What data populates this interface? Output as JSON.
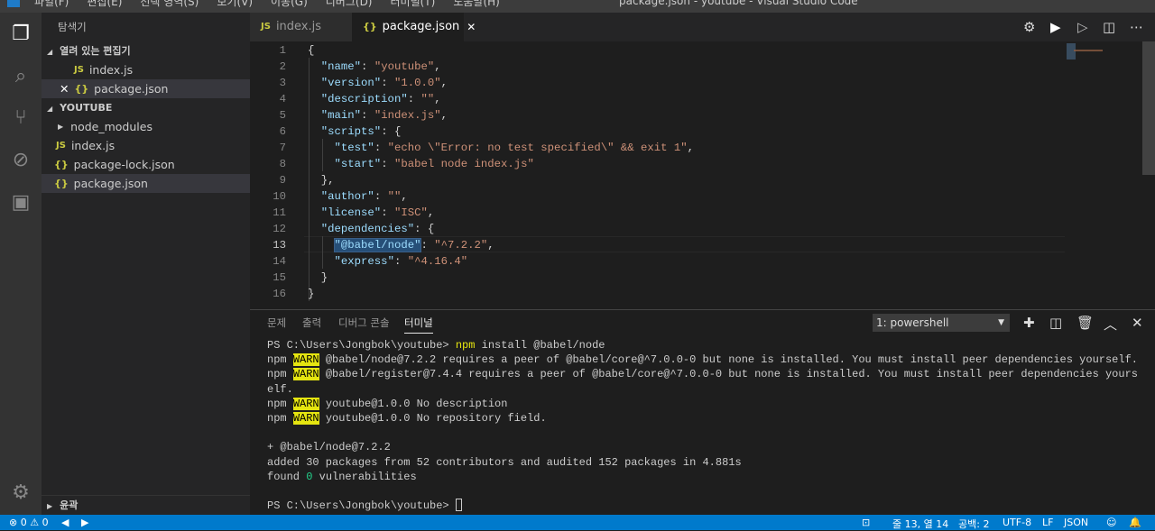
{
  "window": {
    "title": "package.json - youtube - Visual Studio Code",
    "menu": [
      "파일(F)",
      "편집(E)",
      "선택 영역(S)",
      "보기(V)",
      "이동(G)",
      "디버그(D)",
      "터미널(T)",
      "도움말(H)"
    ]
  },
  "activity": [
    "files-icon",
    "search-icon",
    "source-control-icon",
    "debug-icon",
    "extensions-icon"
  ],
  "sidebar": {
    "title": "탐색기",
    "open_editors_label": "열려 있는 편집기",
    "open_editors": [
      {
        "name": "index.js",
        "type": "js"
      },
      {
        "name": "package.json",
        "type": "json"
      }
    ],
    "folder_label": "YOUTUBE",
    "files": [
      {
        "name": "node_modules",
        "type": "folder"
      },
      {
        "name": "index.js",
        "type": "js"
      },
      {
        "name": "package-lock.json",
        "type": "json"
      },
      {
        "name": "package.json",
        "type": "json"
      }
    ],
    "outline_label": "윤곽",
    "js_badge": "JS",
    "json_badge": "{}"
  },
  "tabs": [
    {
      "label": "index.js",
      "type": "js"
    },
    {
      "label": "package.json",
      "type": "json",
      "active": true
    }
  ],
  "editor": {
    "current_line": 13,
    "lines": [
      [
        [
          "p",
          "{"
        ]
      ],
      [
        [
          "p",
          "  "
        ],
        [
          "k",
          "\"name\""
        ],
        [
          "p",
          ": "
        ],
        [
          "s",
          "\"youtube\""
        ],
        [
          "p",
          ","
        ]
      ],
      [
        [
          "p",
          "  "
        ],
        [
          "k",
          "\"version\""
        ],
        [
          "p",
          ": "
        ],
        [
          "s",
          "\"1.0.0\""
        ],
        [
          "p",
          ","
        ]
      ],
      [
        [
          "p",
          "  "
        ],
        [
          "k",
          "\"description\""
        ],
        [
          "p",
          ": "
        ],
        [
          "s",
          "\"\""
        ],
        [
          "p",
          ","
        ]
      ],
      [
        [
          "p",
          "  "
        ],
        [
          "k",
          "\"main\""
        ],
        [
          "p",
          ": "
        ],
        [
          "s",
          "\"index.js\""
        ],
        [
          "p",
          ","
        ]
      ],
      [
        [
          "p",
          "  "
        ],
        [
          "k",
          "\"scripts\""
        ],
        [
          "p",
          ": {"
        ]
      ],
      [
        [
          "p",
          "    "
        ],
        [
          "k",
          "\"test\""
        ],
        [
          "p",
          ": "
        ],
        [
          "s",
          "\"echo \\\"Error: no test specified\\\" && exit 1\""
        ],
        [
          "p",
          ","
        ]
      ],
      [
        [
          "p",
          "    "
        ],
        [
          "k",
          "\"start\""
        ],
        [
          "p",
          ": "
        ],
        [
          "s",
          "\"babel node index.js\""
        ]
      ],
      [
        [
          "p",
          "  },"
        ]
      ],
      [
        [
          "p",
          "  "
        ],
        [
          "k",
          "\"author\""
        ],
        [
          "p",
          ": "
        ],
        [
          "s",
          "\"\""
        ],
        [
          "p",
          ","
        ]
      ],
      [
        [
          "p",
          "  "
        ],
        [
          "k",
          "\"license\""
        ],
        [
          "p",
          ": "
        ],
        [
          "s",
          "\"ISC\""
        ],
        [
          "p",
          ","
        ]
      ],
      [
        [
          "p",
          "  "
        ],
        [
          "k",
          "\"dependencies\""
        ],
        [
          "p",
          ": {"
        ]
      ],
      [
        [
          "p",
          "    "
        ],
        [
          "hl",
          "\"@babel/node\""
        ],
        [
          "p",
          ": "
        ],
        [
          "s",
          "\"^7.2.2\""
        ],
        [
          "p",
          ","
        ]
      ],
      [
        [
          "p",
          "    "
        ],
        [
          "k",
          "\"express\""
        ],
        [
          "p",
          ": "
        ],
        [
          "s",
          "\"^4.16.4\""
        ]
      ],
      [
        [
          "p",
          "  }"
        ]
      ],
      [
        [
          "p",
          "}"
        ]
      ]
    ]
  },
  "panel": {
    "tabs": [
      "문제",
      "출력",
      "디버그 콘솔",
      "터미널"
    ],
    "active_tab": "터미널",
    "terminal_select": "1: powershell",
    "terminal": [
      [
        [
          "t",
          "PS C:\\Users\\Jongbok\\youtube> "
        ],
        [
          "y",
          "npm"
        ],
        [
          "t",
          " install @babel/node"
        ]
      ],
      [
        [
          "t",
          "npm "
        ],
        [
          "w",
          "WARN"
        ],
        [
          "t",
          " @babel/node@7.2.2 requires a peer of @babel/core@^7.0.0-0 but none is installed. You must install peer dependencies yourself."
        ]
      ],
      [
        [
          "t",
          "npm "
        ],
        [
          "w",
          "WARN"
        ],
        [
          "t",
          " @babel/register@7.4.4 requires a peer of @babel/core@^7.0.0-0 but none is installed. You must install peer dependencies yours"
        ]
      ],
      [
        [
          "t",
          "elf."
        ]
      ],
      [
        [
          "t",
          "npm "
        ],
        [
          "w",
          "WARN"
        ],
        [
          "t",
          " youtube@1.0.0 No description"
        ]
      ],
      [
        [
          "t",
          "npm "
        ],
        [
          "w",
          "WARN"
        ],
        [
          "t",
          " youtube@1.0.0 No repository field."
        ]
      ],
      [
        [
          "t",
          ""
        ]
      ],
      [
        [
          "t",
          "+ @babel/node@7.2.2"
        ]
      ],
      [
        [
          "t",
          "added 30 packages from 52 contributors and audited 152 packages in 4.881s"
        ]
      ],
      [
        [
          "t",
          "found "
        ],
        [
          "z",
          "0"
        ],
        [
          "t",
          " vulnerabilities"
        ]
      ],
      [
        [
          "t",
          ""
        ]
      ],
      [
        [
          "t",
          "PS C:\\Users\\Jongbok\\youtube> "
        ],
        [
          "c",
          ""
        ]
      ]
    ]
  },
  "status": {
    "errors": "0",
    "warnings": "0",
    "position": "줄 13, 열 14",
    "spaces": "공백: 2",
    "encoding": "UTF-8",
    "eol": "LF",
    "language": "JSON"
  }
}
